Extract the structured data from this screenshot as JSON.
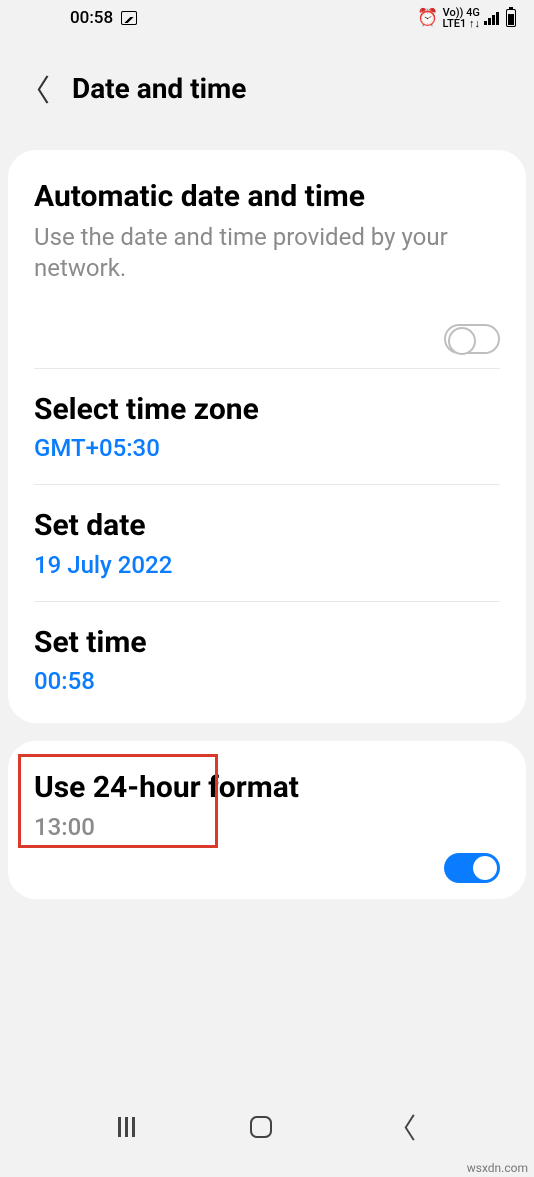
{
  "status": {
    "time": "00:58",
    "lte_label": "Vo)) 4G\nLTE1 ↑↓"
  },
  "header": {
    "title": "Date and time"
  },
  "auto": {
    "title": "Automatic date and time",
    "desc": "Use the date and time provided by your network."
  },
  "timezone": {
    "title": "Select time zone",
    "value": "GMT+05:30"
  },
  "setdate": {
    "title": "Set date",
    "value": "19 July 2022"
  },
  "settime": {
    "title": "Set time",
    "value": "00:58"
  },
  "format24": {
    "title": "Use 24-hour format",
    "value": "13:00"
  },
  "watermark": "wsxdn.com"
}
